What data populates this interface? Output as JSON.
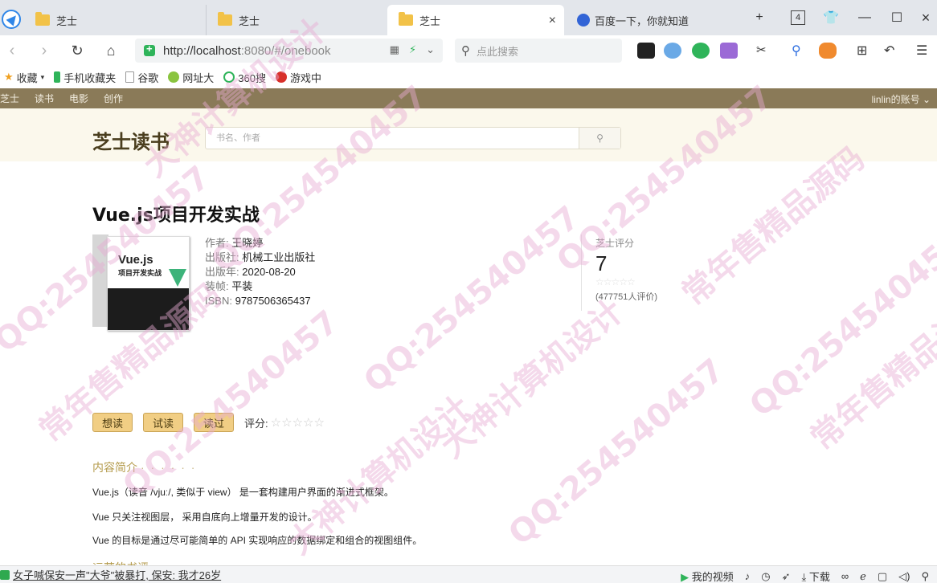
{
  "browser": {
    "tabs": [
      {
        "label": "芝士"
      },
      {
        "label": "芝士"
      },
      {
        "label": "芝士"
      },
      {
        "label": "百度一下，你就知道"
      }
    ],
    "tab_count": "4",
    "url_host": "http://localhost",
    "url_rest": ":8080/#/onebook",
    "search_placeholder": "点此搜索",
    "bookmarks": [
      "收藏",
      "手机收藏夹",
      "谷歌",
      "网址大",
      "360搜",
      "游戏中"
    ]
  },
  "site": {
    "nav": [
      "芝士",
      "读书",
      "电影",
      "创作"
    ],
    "account": "linlin的账号",
    "logo": "芝士读书",
    "search_placeholder": "书名、作者"
  },
  "book": {
    "title": "Vue.js项目开发实战",
    "cover_title": "Vue.js",
    "cover_subtitle": "项目开发实战",
    "author_label": "作者:",
    "author": "王晓婷",
    "publisher_label": "出版社:",
    "publisher": "机械工业出版社",
    "pubdate_label": "出版年:",
    "pubdate": "2020-08-20",
    "binding_label": "装帧:",
    "binding": "平装",
    "isbn_label": "ISBN:",
    "isbn": "9787506365437",
    "rating_label": "芝士评分",
    "rating": "7",
    "rating_stars": "☆☆☆☆☆",
    "rating_count": "(477751人评价)"
  },
  "actions": {
    "want": "想读",
    "trial": "试读",
    "read": "读过",
    "score_label": "评分:",
    "score_stars": "☆☆☆☆☆"
  },
  "intro": {
    "heading": "内容简介",
    "dots": "· · · · · ·",
    "paragraphs": [
      "Vue.js（读音 /vjuː/, 类似于 view） 是一套构建用户界面的渐进式框架。",
      "Vue 只关注视图层， 采用自底向上增量开发的设计。",
      "Vue 的目标是通过尽可能简单的 API 实现响应的数据绑定和组合的视图组件。"
    ],
    "next_heading": "运营的书评"
  },
  "statusbar": {
    "news": "女子喊保安一声\"大爷\"被暴打, 保安: 我才26岁",
    "video": "我的视频",
    "download": "下载"
  },
  "watermarks": [
    "QQ:254540457",
    "大神计算机设计",
    "常年售精品源码"
  ]
}
